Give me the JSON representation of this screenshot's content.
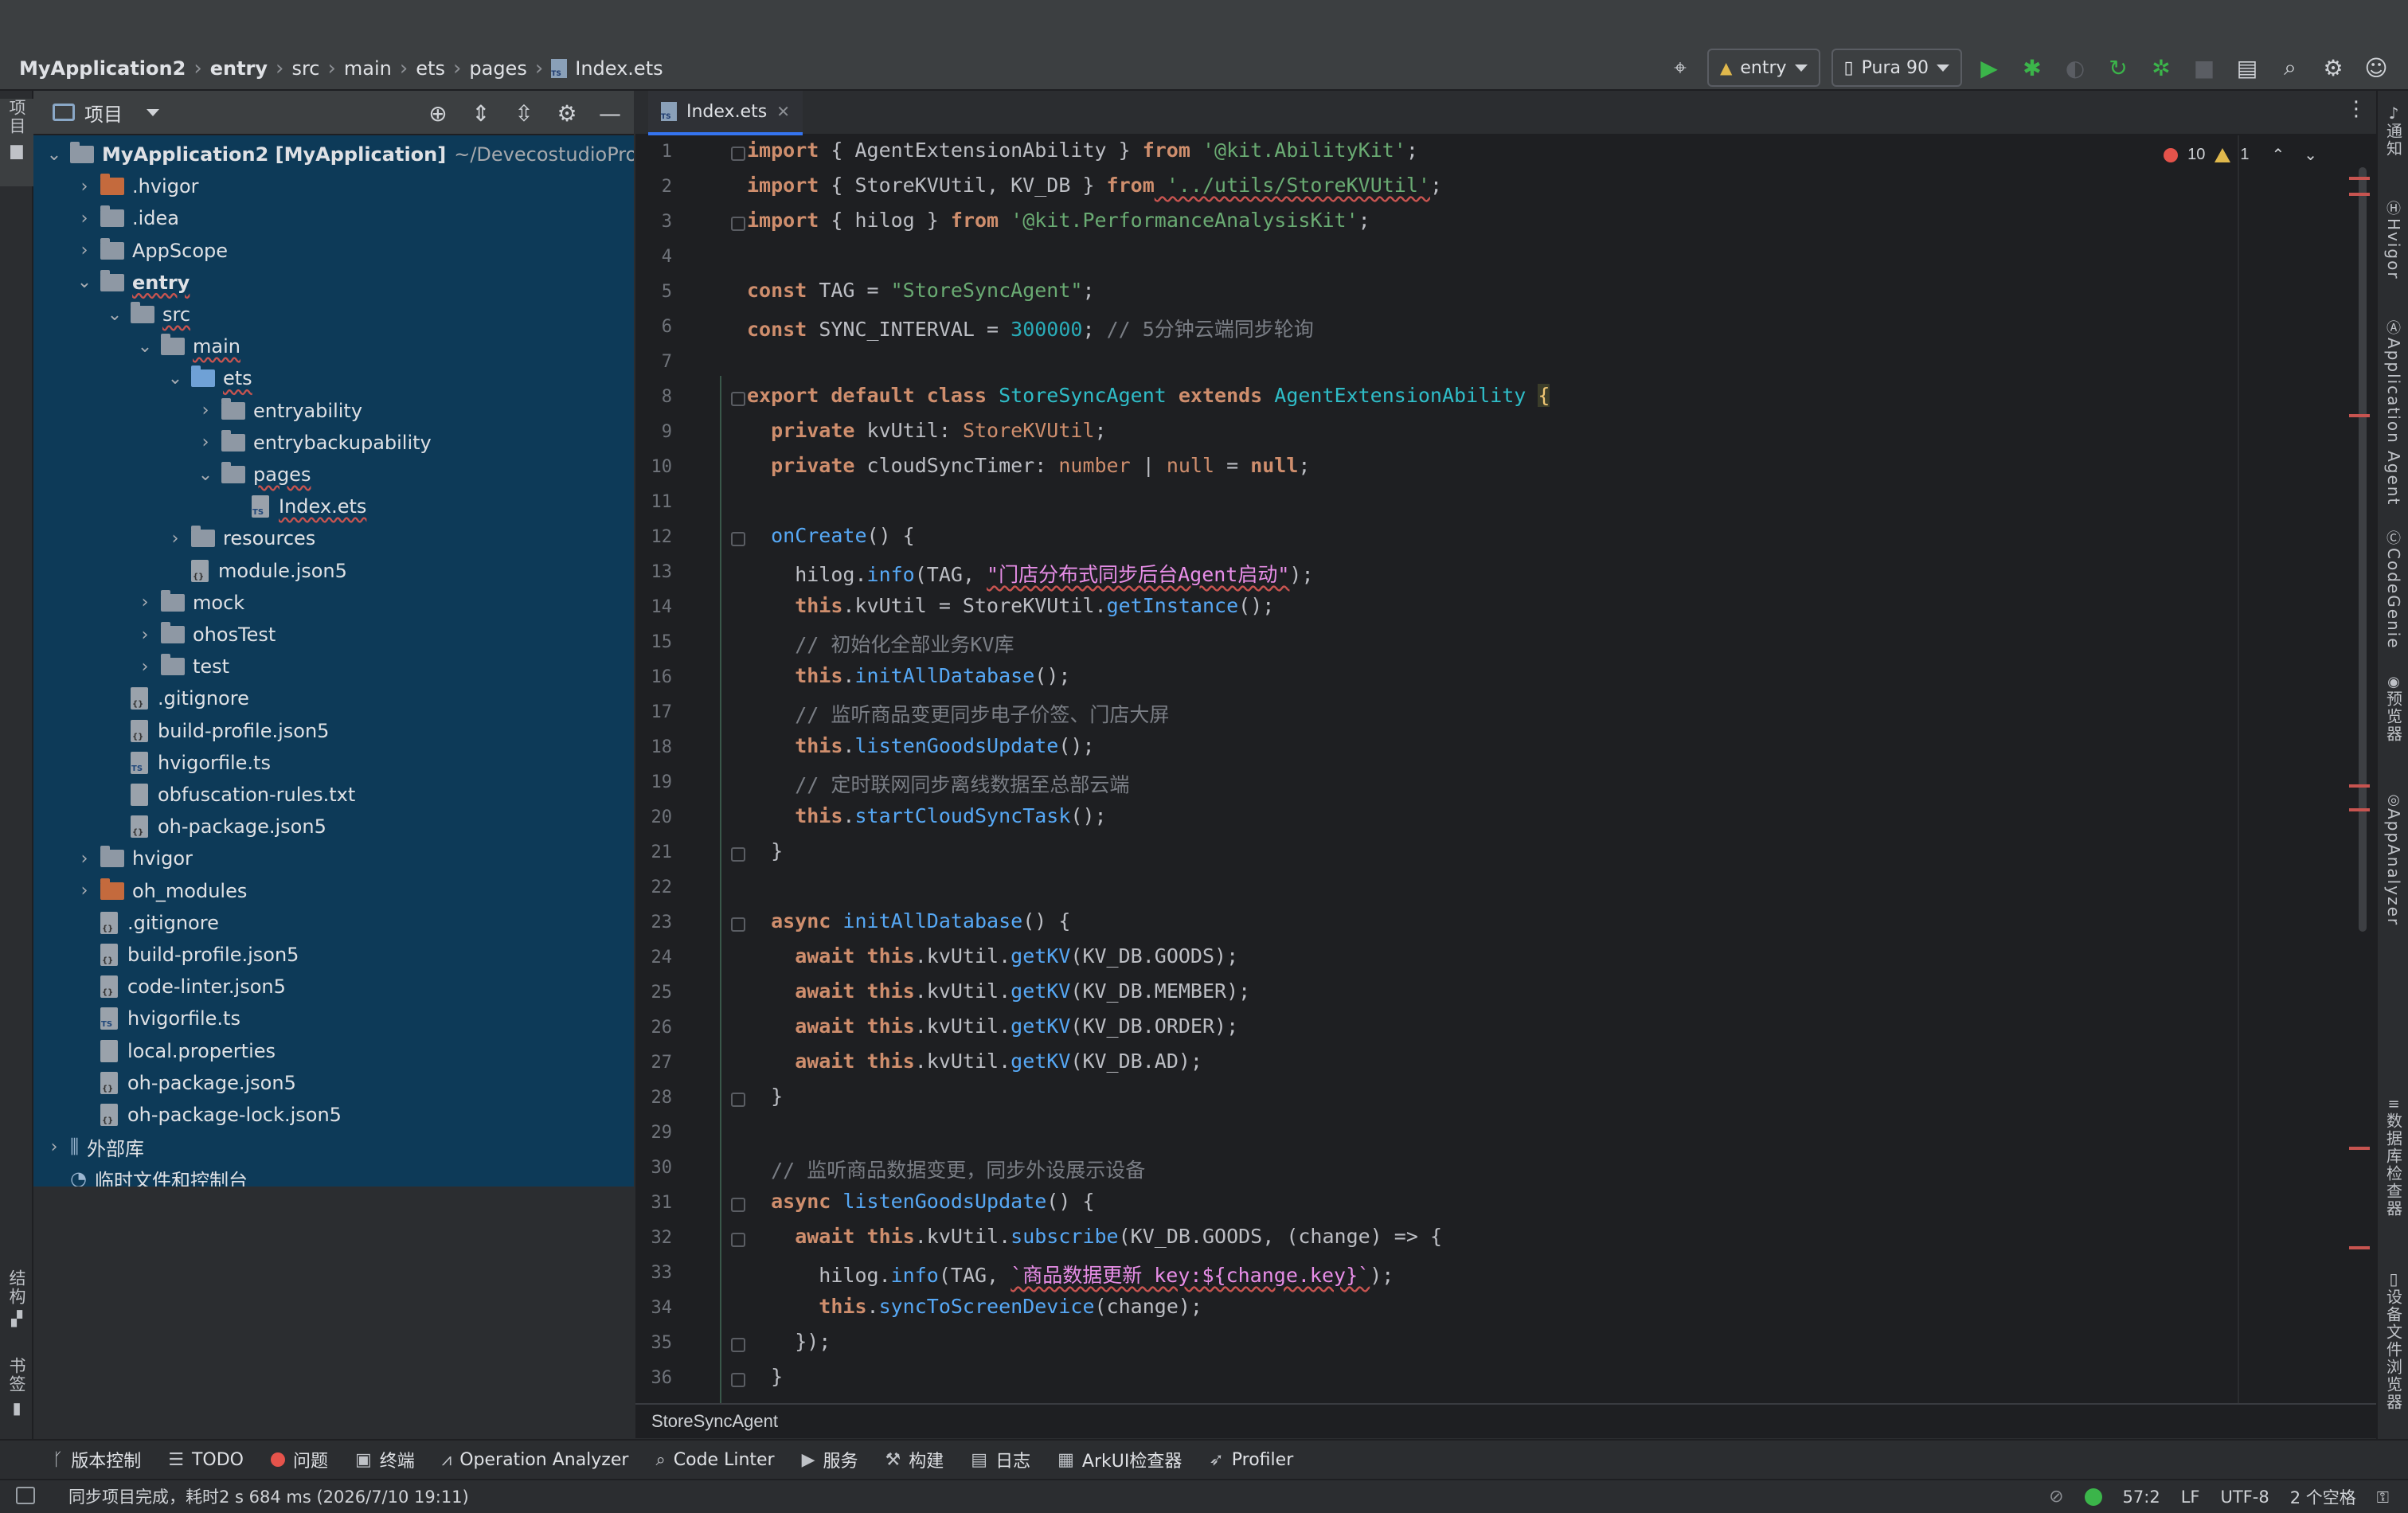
{
  "breadcrumb": [
    "MyApplication2",
    "entry",
    "src",
    "main",
    "ets",
    "pages",
    "Index.ets"
  ],
  "toolbar": {
    "module_combo": "entry",
    "device_combo": "Pura 90"
  },
  "left_strip": {
    "project_tab": "项目",
    "structure_tab": "结构",
    "bookmarks_tab": "书签"
  },
  "project_panel": {
    "title": "项目",
    "tree": [
      {
        "label": "MyApplication2 [MyApplication]",
        "suffix": "~/DevecostudioProjects",
        "depth": 0,
        "type": "module",
        "expanded": true,
        "bold": true
      },
      {
        "label": ".hvigor",
        "depth": 1,
        "type": "folder-orange",
        "expanded": false
      },
      {
        "label": ".idea",
        "depth": 1,
        "type": "folder",
        "expanded": false
      },
      {
        "label": "AppScope",
        "depth": 1,
        "type": "folder",
        "expanded": false
      },
      {
        "label": "entry",
        "depth": 1,
        "type": "module",
        "expanded": true,
        "bold": true
      },
      {
        "label": "src",
        "depth": 2,
        "type": "folder",
        "expanded": true
      },
      {
        "label": "main",
        "depth": 3,
        "type": "folder",
        "expanded": true
      },
      {
        "label": "ets",
        "depth": 4,
        "type": "folder-blue",
        "expanded": true
      },
      {
        "label": "entryability",
        "depth": 5,
        "type": "folder",
        "expanded": false
      },
      {
        "label": "entrybackupability",
        "depth": 5,
        "type": "folder",
        "expanded": false
      },
      {
        "label": "pages",
        "depth": 5,
        "type": "folder",
        "expanded": true
      },
      {
        "label": "Index.ets",
        "depth": 6,
        "type": "file-ts"
      },
      {
        "label": "resources",
        "depth": 4,
        "type": "folder",
        "expanded": false
      },
      {
        "label": "module.json5",
        "depth": 4,
        "type": "file-json"
      },
      {
        "label": "mock",
        "depth": 3,
        "type": "folder",
        "expanded": false
      },
      {
        "label": "ohosTest",
        "depth": 3,
        "type": "folder",
        "expanded": false
      },
      {
        "label": "test",
        "depth": 3,
        "type": "folder",
        "expanded": false
      },
      {
        "label": ".gitignore",
        "depth": 2,
        "type": "file-json"
      },
      {
        "label": "build-profile.json5",
        "depth": 2,
        "type": "file-json"
      },
      {
        "label": "hvigorfile.ts",
        "depth": 2,
        "type": "file-ts"
      },
      {
        "label": "obfuscation-rules.txt",
        "depth": 2,
        "type": "file"
      },
      {
        "label": "oh-package.json5",
        "depth": 2,
        "type": "file-json"
      },
      {
        "label": "hvigor",
        "depth": 1,
        "type": "folder",
        "expanded": false
      },
      {
        "label": "oh_modules",
        "depth": 1,
        "type": "folder-orange",
        "expanded": false
      },
      {
        "label": ".gitignore",
        "depth": 1,
        "type": "file-json"
      },
      {
        "label": "build-profile.json5",
        "depth": 1,
        "type": "file-json"
      },
      {
        "label": "code-linter.json5",
        "depth": 1,
        "type": "file-json"
      },
      {
        "label": "hvigorfile.ts",
        "depth": 1,
        "type": "file-ts"
      },
      {
        "label": "local.properties",
        "depth": 1,
        "type": "file"
      },
      {
        "label": "oh-package.json5",
        "depth": 1,
        "type": "file-json"
      },
      {
        "label": "oh-package-lock.json5",
        "depth": 1,
        "type": "file-json"
      },
      {
        "label": "外部库",
        "depth": 0,
        "type": "library",
        "expanded": false
      },
      {
        "label": "临时文件和控制台",
        "depth": 0,
        "type": "scratch"
      }
    ]
  },
  "editor": {
    "tab_label": "Index.ets",
    "errors": "10",
    "warnings": "1",
    "bottom_breadcrumb": "StoreSyncAgent",
    "lines": [
      "1",
      "2",
      "3",
      "4",
      "5",
      "6",
      "7",
      "8",
      "9",
      "10",
      "11",
      "12",
      "13",
      "14",
      "15",
      "16",
      "17",
      "18",
      "19",
      "20",
      "21",
      "22",
      "23",
      "24",
      "25",
      "26",
      "27",
      "28",
      "29",
      "30",
      "31",
      "32",
      "33",
      "34",
      "35",
      "36"
    ],
    "code": {
      "l1_a": "import",
      "l1_b": " { ",
      "l1_c": "AgentExtensionAbility",
      "l1_d": " } ",
      "l1_e": "from",
      "l1_f": " '@kit.AbilityKit'",
      "l1_g": ";",
      "l2_a": "import",
      "l2_b": " { StoreKVUtil, KV_DB } ",
      "l2_c": "from",
      "l2_d": " '../utils/StoreKVUtil'",
      "l2_e": ";",
      "l3_a": "import",
      "l3_b": " { hilog } ",
      "l3_c": "from",
      "l3_d": " '@kit.PerformanceAnalysisKit'",
      "l3_e": ";",
      "l5_a": "const",
      "l5_b": " TAG = ",
      "l5_c": "\"StoreSyncAgent\"",
      "l5_d": ";",
      "l6_a": "const",
      "l6_b": " SYNC_INTERVAL = ",
      "l6_c": "300000",
      "l6_d": "; ",
      "l6_e": "// 5分钟云端同步轮询",
      "l8_a": "export default class",
      "l8_b": " StoreSyncAgent ",
      "l8_c": "extends",
      "l8_d": " AgentExtensionAbility ",
      "l8_e": "{",
      "l9_a": "  private",
      "l9_b": " kvUtil: ",
      "l9_c": "StoreKVUtil",
      "l9_d": ";",
      "l10_a": "  private",
      "l10_b": " cloudSyncTimer: ",
      "l10_c": "number",
      "l10_d": " | ",
      "l10_e": "null",
      "l10_f": " = ",
      "l10_g": "null",
      "l10_h": ";",
      "l12_a": "  onCreate",
      "l12_b": "() {",
      "l13_a": "    hilog.",
      "l13_b": "info",
      "l13_c": "(TAG, ",
      "l13_d": "\"门店分布式同步后台Agent启动\"",
      "l13_e": ");",
      "l14_a": "    this",
      "l14_b": ".kvUtil = StoreKVUtil.",
      "l14_c": "getInstance",
      "l14_d": "();",
      "l15_a": "    // 初始化全部业务KV库",
      "l16_a": "    this",
      "l16_b": ".",
      "l16_c": "initAllDatabase",
      "l16_d": "();",
      "l17_a": "    // 监听商品变更同步电子价签、门店大屏",
      "l18_a": "    this",
      "l18_b": ".",
      "l18_c": "listenGoodsUpdate",
      "l18_d": "();",
      "l19_a": "    // 定时联网同步离线数据至总部云端",
      "l20_a": "    this",
      "l20_b": ".",
      "l20_c": "startCloudSyncTask",
      "l20_d": "();",
      "l21_a": "  }",
      "l23_a": "  async",
      "l23_b": " initAllDatabase",
      "l23_c": "() {",
      "l24_a": "    await this",
      "l24_b": ".kvUtil.",
      "l24_c": "getKV",
      "l24_d": "(KV_DB.GOODS);",
      "l25_a": "    await this",
      "l25_b": ".kvUtil.",
      "l25_c": "getKV",
      "l25_d": "(KV_DB.MEMBER);",
      "l26_a": "    await this",
      "l26_b": ".kvUtil.",
      "l26_c": "getKV",
      "l26_d": "(KV_DB.ORDER);",
      "l27_a": "    await this",
      "l27_b": ".kvUtil.",
      "l27_c": "getKV",
      "l27_d": "(KV_DB.AD);",
      "l28_a": "  }",
      "l30_a": "  // 监听商品数据变更，同步外设展示设备",
      "l31_a": "  async",
      "l31_b": " listenGoodsUpdate",
      "l31_c": "() {",
      "l32_a": "    await this",
      "l32_b": ".kvUtil.",
      "l32_c": "subscribe",
      "l32_d": "(KV_DB.GOODS, (change) => {",
      "l33_a": "      hilog.",
      "l33_b": "info",
      "l33_c": "(TAG, ",
      "l33_d": "`商品数据更新 key:${change.key}`",
      "l33_e": ");",
      "l34_a": "      this",
      "l34_b": ".",
      "l34_c": "syncToScreenDevice",
      "l34_d": "(change);",
      "l35_a": "    });",
      "l36_a": "  }"
    }
  },
  "right_strip": [
    "通知",
    "Hvigor",
    "Application Agent",
    "CodeGenie",
    "预览器",
    "AppAnalyzer",
    "数据库检查器",
    "设备文件浏览器"
  ],
  "tool_windows": [
    "版本控制",
    "TODO",
    "问题",
    "终端",
    "Operation Analyzer",
    "Code Linter",
    "服务",
    "构建",
    "日志",
    "ArkUI检查器",
    "Profiler"
  ],
  "status": {
    "message": "同步项目完成，耗时2 s 684 ms (2026/7/10 19:11)",
    "position": "57:2",
    "line_sep": "LF",
    "encoding": "UTF-8",
    "indent": "2 个空格"
  }
}
